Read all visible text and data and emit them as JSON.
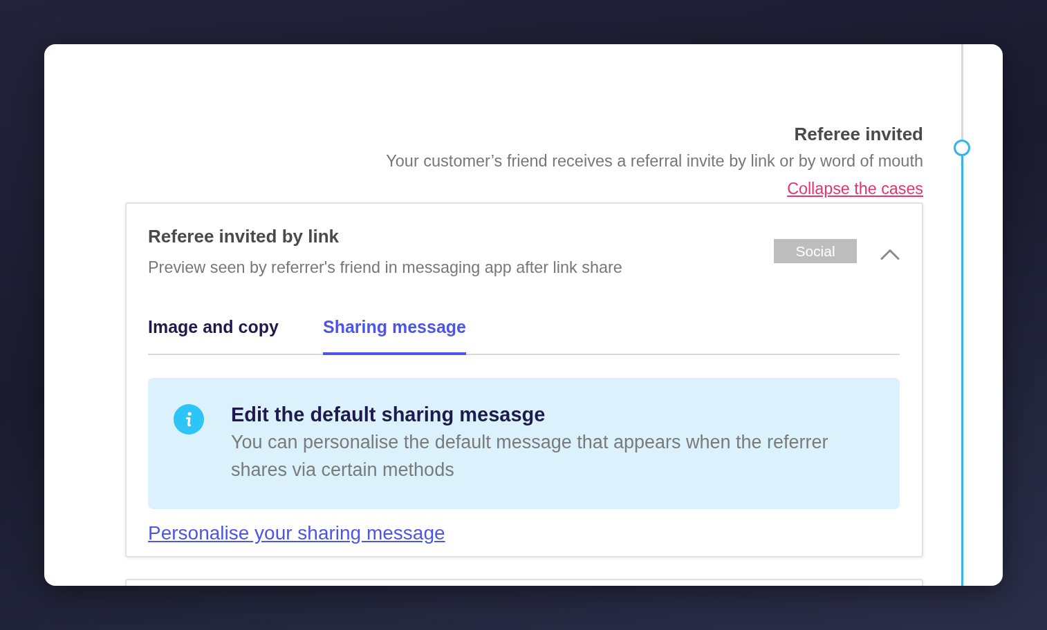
{
  "step": {
    "title": "Referee invited",
    "description": "Your customer’s friend receives a referral invite by link or by word of mouth",
    "collapse_link": "Collapse the cases",
    "active": true
  },
  "cases": [
    {
      "title": "Referee invited by link",
      "subtitle": "Preview seen by referrer's friend in messaging app after link share",
      "tag": "Social",
      "expanded": true,
      "tabs": [
        {
          "label": "Image and copy",
          "selected": false
        },
        {
          "label": "Sharing message",
          "selected": true
        }
      ],
      "info": {
        "title": "Edit the default sharing mesasge",
        "body": "You can personalise the default message that appears when the referrer shares via certain methods"
      },
      "link": "Personalise your sharing message"
    }
  ]
}
